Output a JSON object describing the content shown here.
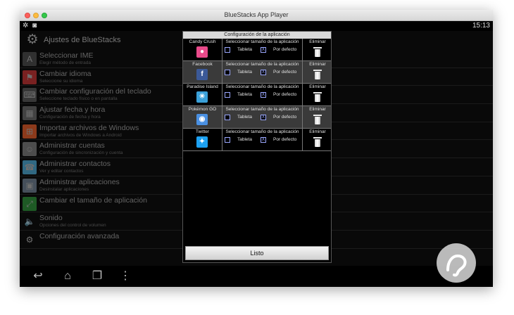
{
  "window": {
    "title": "BlueStacks App Player"
  },
  "statusbar": {
    "time": "15:13",
    "icons": [
      "bluetooth-icon",
      "camera-icon"
    ]
  },
  "settings": {
    "title": "Ajustes de BlueStacks",
    "items": [
      {
        "title": "Seleccionar IME",
        "subtitle": "Elegir método de entrada",
        "icon": "keyboard-a-icon"
      },
      {
        "title": "Cambiar idioma",
        "subtitle": "Seleccione su idioma",
        "icon": "flags-icon"
      },
      {
        "title": "Cambiar configuración del teclado",
        "subtitle": "Seleccione teclado físico o en pantalla",
        "icon": "keyboard-icon"
      },
      {
        "title": "Ajustar fecha y hora",
        "subtitle": "Configuración de fecha y hora",
        "icon": "calendar-icon"
      },
      {
        "title": "Importar archivos de Windows",
        "subtitle": "Importar archivos de Windows a Android",
        "icon": "windows-icon"
      },
      {
        "title": "Administrar cuentas",
        "subtitle": "Configuración de sincronización y cuenta",
        "icon": "account-icon"
      },
      {
        "title": "Administrar contactos",
        "subtitle": "Ver y editar contactos",
        "icon": "contacts-icon"
      },
      {
        "title": "Administrar aplicaciones",
        "subtitle": "Desinstalar aplicaciones",
        "icon": "apps-icon"
      },
      {
        "title": "Cambiar el tamaño de aplicación",
        "subtitle": "",
        "icon": "resize-icon"
      },
      {
        "title": "Sonido",
        "subtitle": "Opciones del control de volumen",
        "icon": "speaker-icon"
      },
      {
        "title": "Configuración avanzada",
        "subtitle": "",
        "icon": "gear-icon"
      }
    ]
  },
  "dialog": {
    "title": "Configuración de la aplicación",
    "size_header": "Seleccionar tamaño de la aplicación",
    "tablet_label": "Tableta",
    "default_label": "Por defecto",
    "delete_label": "Eliminar",
    "done_label": "Listo",
    "apps": [
      {
        "name": "Candy Crush",
        "icon": "candy-crush-icon",
        "color": "#e84a8a",
        "glyph": "●"
      },
      {
        "name": "Facebook",
        "icon": "facebook-icon",
        "color": "#3b5998",
        "glyph": "f"
      },
      {
        "name": "Paradise Island",
        "icon": "paradise-island-icon",
        "color": "#3aa0d8",
        "glyph": "☀"
      },
      {
        "name": "Pokémon GO",
        "icon": "pokemon-go-icon",
        "color": "#4a90e2",
        "glyph": "◉"
      },
      {
        "name": "Twitter",
        "icon": "twitter-icon",
        "color": "#1da1f2",
        "glyph": "✦"
      }
    ]
  }
}
